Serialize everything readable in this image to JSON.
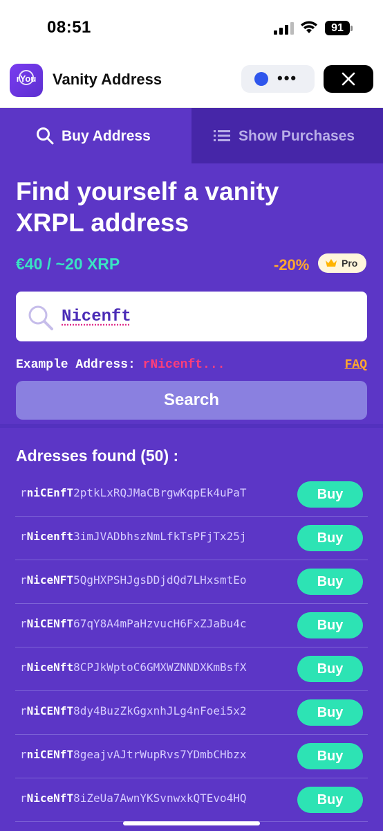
{
  "status_bar": {
    "time": "08:51",
    "battery": "91"
  },
  "header": {
    "logo_text": "rYou",
    "title": "Vanity Address"
  },
  "tabs": [
    {
      "label": "Buy Address",
      "icon": "search-icon",
      "active": true
    },
    {
      "label": "Show Purchases",
      "icon": "list-icon",
      "active": false
    }
  ],
  "hero": {
    "title": "Find yourself a vanity XRPL address",
    "price": "€40 / ~20 XRP",
    "discount": "-20%",
    "pro_label": "Pro"
  },
  "search": {
    "value": "Nicenft",
    "example_label": "Example Address:",
    "example_value": "rNicenft...",
    "faq": "FAQ",
    "button": "Search"
  },
  "results": {
    "heading": "Adresses found (50) :",
    "buy_label": "Buy",
    "rows": [
      {
        "prefix": "r",
        "match": "niCEnfT",
        "rest": "2ptkLxRQJMaCBrgwKqpEk4uPaT"
      },
      {
        "prefix": "r",
        "match": "Nicenft",
        "rest": "3imJVADbhszNmLfkTsPFjTx25j"
      },
      {
        "prefix": "r",
        "match": "NiceNFT",
        "rest": "5QgHXPSHJgsDDjdQd7LHxsmtEo"
      },
      {
        "prefix": "r",
        "match": "NiCENfT",
        "rest": "67qY8A4mPaHzvucH6FxZJaBu4c"
      },
      {
        "prefix": "r",
        "match": "NiceNft",
        "rest": "8CPJkWptoC6GMXWZNNDXKmBsfX"
      },
      {
        "prefix": "r",
        "match": "NiCENfT",
        "rest": "8dy4BuzZkGgxnhJLg4nFoei5x2"
      },
      {
        "prefix": "r",
        "match": "niCENfT",
        "rest": "8geajvAJtrWupRvs7YDmbCHbzx"
      },
      {
        "prefix": "r",
        "match": "NiceNfT",
        "rest": "8iZeUa7AwnYKSvnwxkQTEvo4HQ"
      }
    ]
  },
  "colors": {
    "background": "#5c36c6",
    "price": "#39e3c3",
    "discount": "#ffa72e",
    "example": "#ff3e7a",
    "buy_button": "#2de3b4",
    "search_button": "#8a80e0"
  }
}
